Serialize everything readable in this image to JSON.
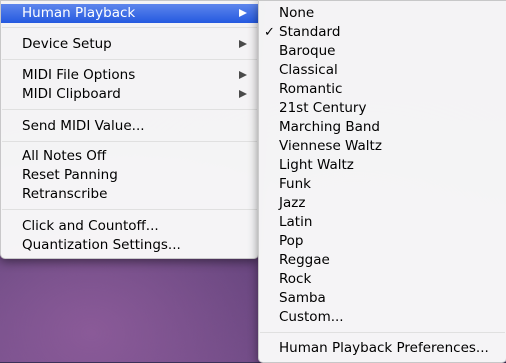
{
  "main_menu": {
    "items": [
      {
        "label": "Human Playback"
      },
      {
        "label": "Device Setup"
      },
      {
        "label": "MIDI File Options"
      },
      {
        "label": "MIDI Clipboard"
      },
      {
        "label": "Send MIDI Value..."
      },
      {
        "label": "All Notes Off"
      },
      {
        "label": "Reset Panning"
      },
      {
        "label": "Retranscribe"
      },
      {
        "label": "Click and Countoff..."
      },
      {
        "label": "Quantization Settings..."
      }
    ]
  },
  "submenu": {
    "check_glyph": "✓",
    "items": [
      {
        "label": "None"
      },
      {
        "label": "Standard",
        "checked": true
      },
      {
        "label": "Baroque"
      },
      {
        "label": "Classical"
      },
      {
        "label": "Romantic"
      },
      {
        "label": "21st Century"
      },
      {
        "label": "Marching Band"
      },
      {
        "label": "Viennese Waltz"
      },
      {
        "label": "Light Waltz"
      },
      {
        "label": "Funk"
      },
      {
        "label": "Jazz"
      },
      {
        "label": "Latin"
      },
      {
        "label": "Pop"
      },
      {
        "label": "Reggae"
      },
      {
        "label": "Rock"
      },
      {
        "label": "Samba"
      },
      {
        "label": "Custom..."
      },
      {
        "label": "Human Playback Preferences..."
      }
    ]
  },
  "colors": {
    "highlight": "#2459e0",
    "menu_bg": "#fafafa"
  }
}
